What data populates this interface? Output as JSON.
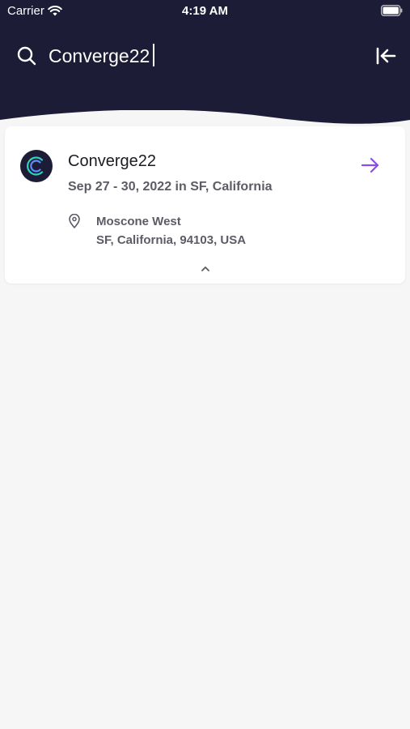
{
  "status_bar": {
    "carrier": "Carrier",
    "time": "4:19 AM"
  },
  "search": {
    "value": "Converge22",
    "placeholder": ""
  },
  "results": [
    {
      "title": "Converge22",
      "dates": "Sep 27 - 30, 2022 in SF, California",
      "venue_name": "Moscone West",
      "venue_address": "SF, California, 94103, USA"
    }
  ],
  "colors": {
    "header_bg": "#1d1c36",
    "accent": "#8a4bf0",
    "page_bg": "#f6f6f7",
    "logo_ring": "#2fd3c0"
  },
  "icons": {
    "wifi": "wifi-icon",
    "battery": "battery-icon",
    "search": "search-icon",
    "collapse": "collapse-left-icon",
    "arrow": "arrow-right-icon",
    "pin": "location-pin-icon",
    "chevron": "chevron-up-icon"
  }
}
